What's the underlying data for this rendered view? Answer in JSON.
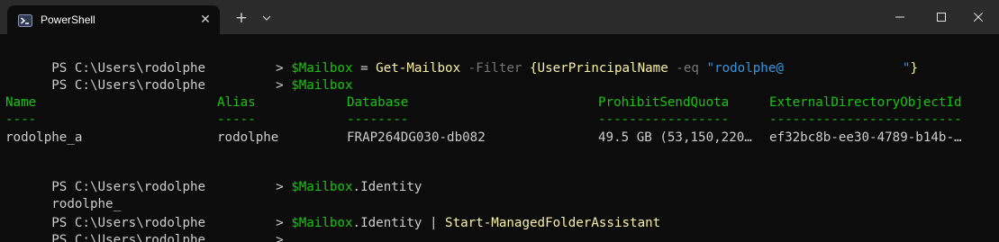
{
  "window": {
    "tab_title": "PowerShell",
    "tab_close_glyph": "✕",
    "new_tab_glyph": "+",
    "dropdown_glyph": "⌄",
    "colors": {
      "background": "#0c0c0c",
      "titlebar": "#2b2b2b",
      "text": "#cccccc",
      "variable": "#16c60c",
      "command": "#f9f1a5",
      "parameter": "#767676",
      "string": "#3a96dd",
      "table_header": "#16c60c"
    },
    "icons": [
      "powershell-icon",
      "close-icon",
      "plus-icon",
      "chevron-down-icon",
      "minimize-icon",
      "maximize-icon",
      "window-close-icon"
    ]
  },
  "terminal": {
    "line1": {
      "prompt": "PS C:\\Users\\rodolphe",
      "prompt_end": "> ",
      "var": "$Mailbox",
      "op1": " = ",
      "cmd": "Get-Mailbox",
      "param1": " -Filter ",
      "brace_open": "{",
      "prop": "UserPrincipalName",
      "param2": " -eq ",
      "str_start": "\"rodolphe@",
      "str_end": "\"",
      "brace_close": "}"
    },
    "line2": {
      "prompt": "PS C:\\Users\\rodolphe",
      "prompt_end": "> ",
      "var": "$Mailbox"
    },
    "table": {
      "headers": [
        "Name",
        "Alias",
        "Database",
        "ProhibitSendQuota",
        "ExternalDirectoryObjectId"
      ],
      "underlines": [
        "----",
        "-----",
        "--------",
        "-----------------",
        "-------------------------"
      ],
      "row": [
        "rodolphe_a",
        "rodolphe",
        "FRAP264DG030-db082",
        "49.5 GB (53,150,220…",
        "ef32bc8b-ee30-4789-b14b-…"
      ]
    },
    "line3": {
      "prompt": "PS C:\\Users\\rodolphe",
      "prompt_end": "> ",
      "var": "$Mailbox",
      "rest": ".Identity"
    },
    "line4": {
      "output": "rodolphe_"
    },
    "line5": {
      "prompt": "PS C:\\Users\\rodolphe",
      "prompt_end": "> ",
      "var": "$Mailbox",
      "rest": ".Identity | ",
      "cmd": "Start-ManagedFolderAssistant"
    },
    "line6": {
      "prompt": "PS C:\\Users\\rodolphe",
      "prompt_end": ">"
    }
  }
}
